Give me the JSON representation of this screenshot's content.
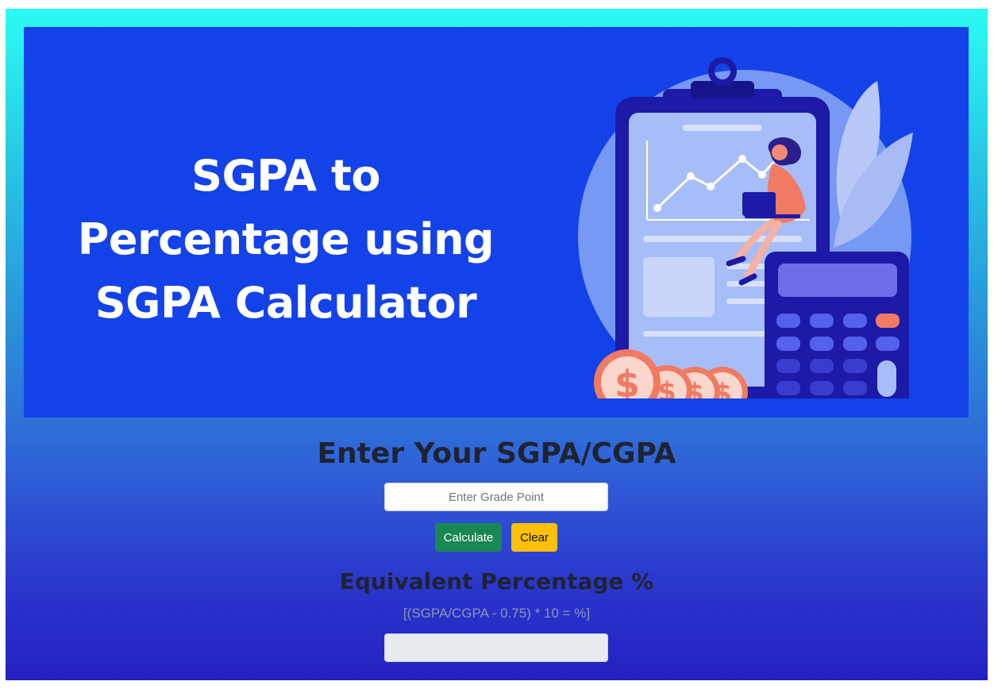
{
  "banner": {
    "title_lines": [
      "SGPA to",
      "Percentage using",
      "SGPA Calculator"
    ],
    "background_color": "#1342e9",
    "illustration_icons": [
      "clipboard-icon",
      "line-chart-icon",
      "woman-with-laptop-icon",
      "calculator-icon",
      "dollar-coin-icon",
      "leaf-icon"
    ]
  },
  "form": {
    "heading": "Enter Your SGPA/CGPA",
    "input": {
      "placeholder": "Enter Grade Point",
      "value": ""
    },
    "calculate_label": "Calculate",
    "clear_label": "Clear"
  },
  "result": {
    "heading": "Equivalent Percentage %",
    "formula": "[(SGPA/CGPA - 0.75) * 10 = %]",
    "value": ""
  },
  "colors": {
    "calculate_button": "#198754",
    "clear_button": "#ffc107",
    "gradient_top": "#2bfcf2",
    "gradient_bottom": "#2521c2"
  }
}
